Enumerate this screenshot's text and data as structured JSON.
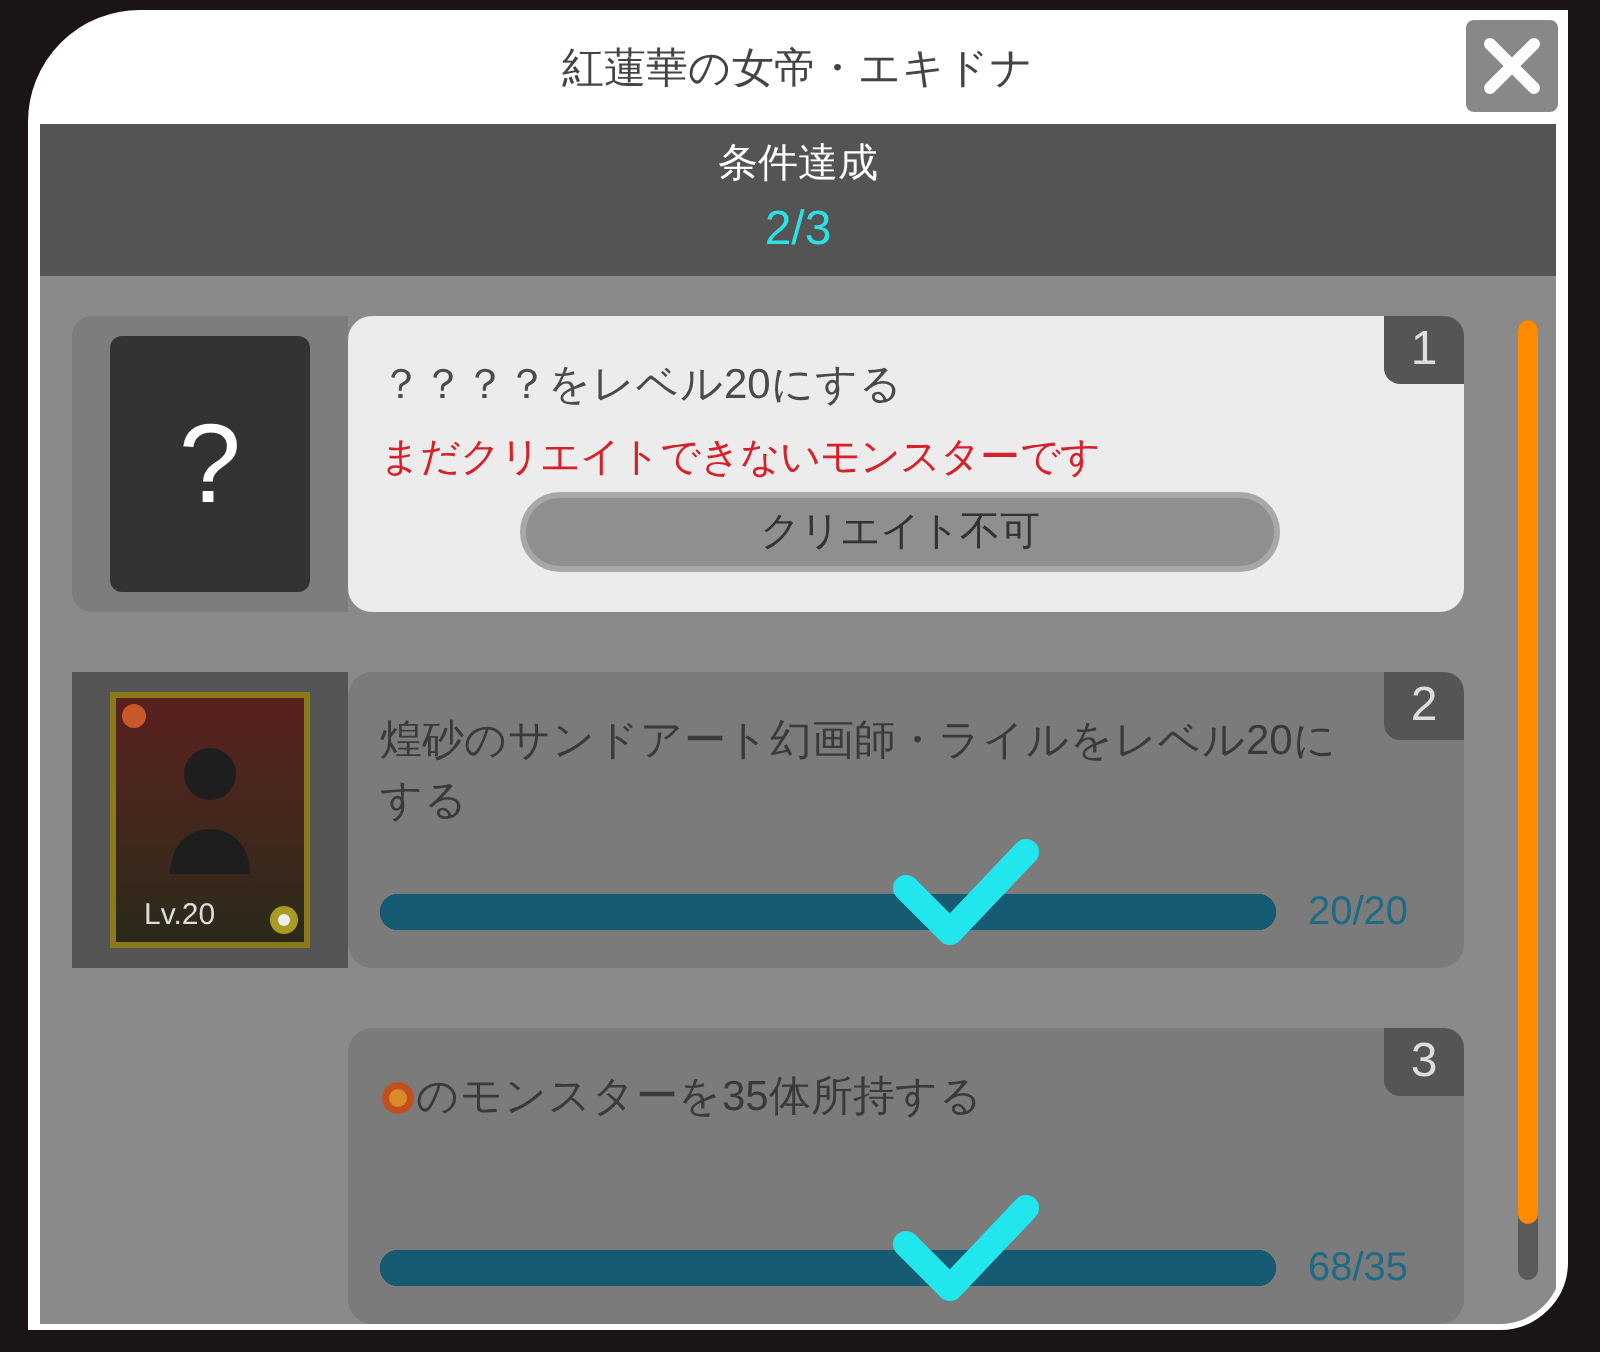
{
  "dialog": {
    "title": "紅蓮華の女帝・エキドナ"
  },
  "header": {
    "label": "条件達成",
    "progress": "2/3"
  },
  "conditions": [
    {
      "number": "1",
      "kind": "locked",
      "completed": false,
      "text": "？？？？をレベル20にする",
      "icon_text": "?",
      "warning": "まだクリエイトできないモンスターです",
      "button": "クリエイト不可"
    },
    {
      "number": "2",
      "kind": "monster",
      "completed": true,
      "text": "煌砂のサンドアート幻画師・ライルをレベル20にする",
      "portrait_level": "Lv.20",
      "level": 1,
      "reading": "20/20"
    },
    {
      "number": "3",
      "kind": "attribute",
      "completed": true,
      "text": "のモンスターを35体所持する",
      "level": 1,
      "reading": "68/35"
    }
  ]
}
